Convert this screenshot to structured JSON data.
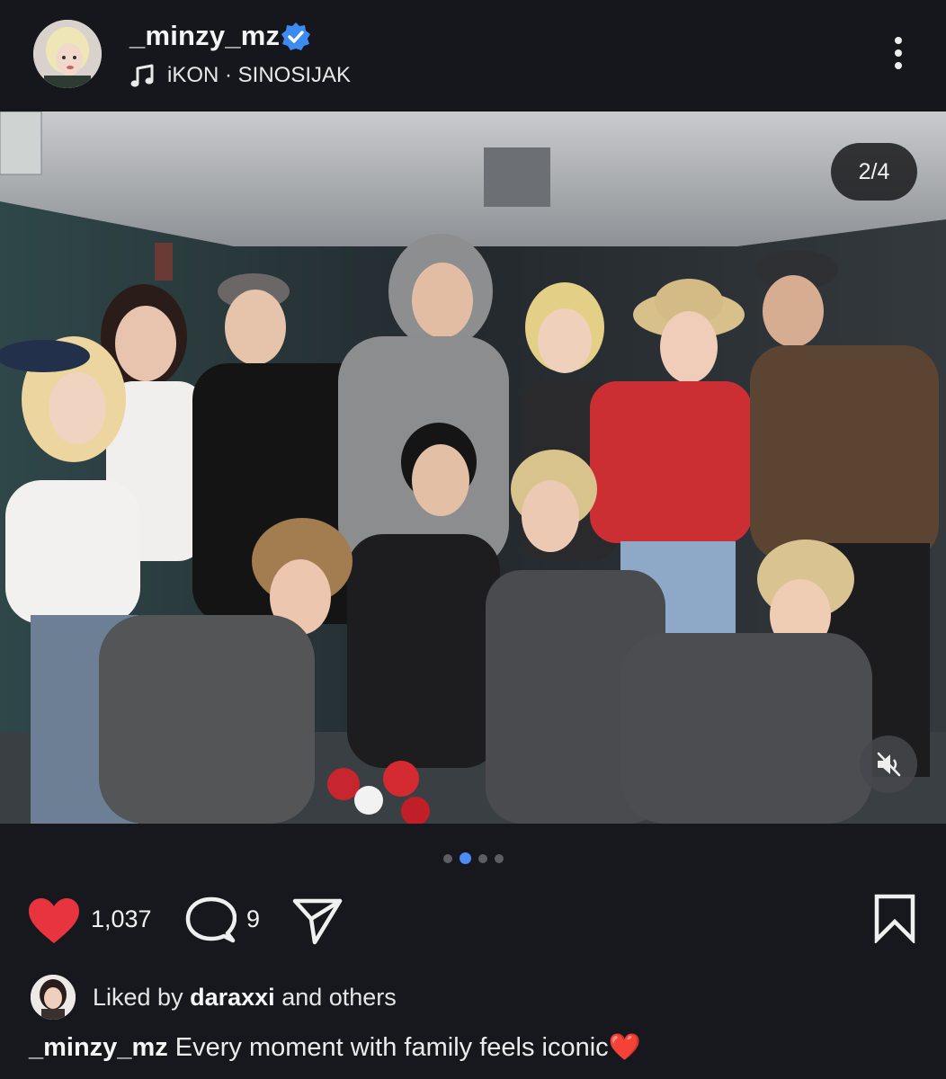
{
  "header": {
    "username": "_minzy_mz",
    "verified": true,
    "music_icon": "music-note-icon",
    "music_text": "iKON · SINOSIJAK",
    "more_icon": "more-vertical-icon"
  },
  "post": {
    "image_counter": "2/4",
    "mute_icon": "muted-speaker-icon",
    "carousel": {
      "total": 4,
      "active_index": 1
    }
  },
  "actions": {
    "like_icon": "heart-filled-icon",
    "like_count": "1,037",
    "comment_icon": "comment-bubble-icon",
    "comment_count": "9",
    "share_icon": "send-icon",
    "bookmark_icon": "bookmark-icon",
    "like_color": "#e8343f"
  },
  "liked_by": {
    "prefix": "Liked by",
    "user": "daraxxi",
    "suffix": "and others"
  },
  "caption": {
    "username": "_minzy_mz",
    "text": "Every moment with family feels iconic",
    "emoji": "❤️"
  },
  "colors": {
    "background": "#17181d",
    "verified_badge": "#3d8bf0",
    "active_dot": "#4d8bf5"
  }
}
